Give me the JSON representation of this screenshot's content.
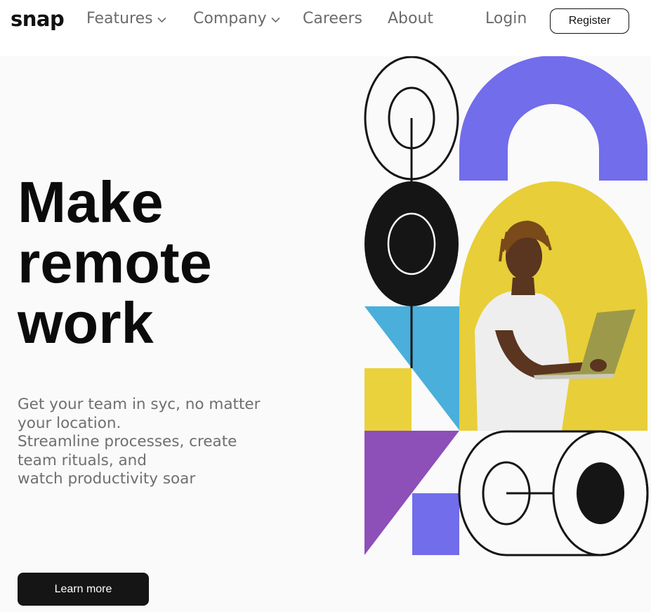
{
  "nav": {
    "logo": "snap",
    "features_label": "Features",
    "company_label": "Company",
    "careers_label": "Careers",
    "about_label": "About",
    "login_label": "Login",
    "register_label": "Register"
  },
  "hero": {
    "title_lines": [
      "Make",
      "remote",
      "work"
    ],
    "description_lines": [
      "Get your team in syc, no matter",
      "your location.",
      "Streamline processes, create",
      "team rituals, and",
      "watch productivity soar"
    ],
    "cta_label": "Learn more"
  },
  "colors": {
    "purple": "#716deb",
    "yellow": "#ead23d",
    "blue": "#4aafdb",
    "violet": "#8d4fb8",
    "dark": "#151515"
  }
}
